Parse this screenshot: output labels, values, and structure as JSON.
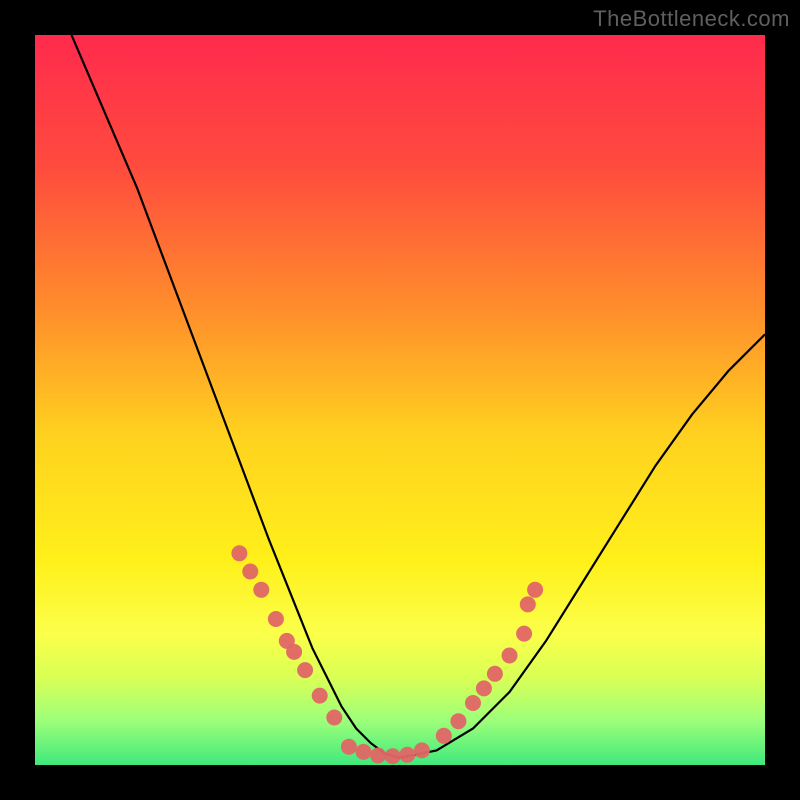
{
  "watermark": "TheBottleneck.com",
  "chart_data": {
    "type": "line",
    "title": "",
    "xlabel": "",
    "ylabel": "",
    "xlim": [
      0,
      100
    ],
    "ylim": [
      0,
      100
    ],
    "grid": false,
    "background": "vertical-gradient red→yellow→green",
    "series": [
      {
        "name": "bottleneck-curve",
        "type": "line",
        "x": [
          5,
          8,
          11,
          14,
          17,
          20,
          23,
          26,
          29,
          32,
          34,
          36,
          38,
          40,
          42,
          44,
          46,
          48,
          50,
          55,
          60,
          65,
          70,
          75,
          80,
          85,
          90,
          95,
          100
        ],
        "y": [
          100,
          93,
          86,
          79,
          71,
          63,
          55,
          47,
          39,
          31,
          26,
          21,
          16,
          12,
          8,
          5,
          3,
          1.5,
          1,
          2,
          5,
          10,
          17,
          25,
          33,
          41,
          48,
          54,
          59
        ]
      },
      {
        "name": "left-dots",
        "type": "scatter",
        "color": "#e06666",
        "x": [
          28,
          29.5,
          31,
          33,
          34.5,
          35.5,
          37,
          39,
          41
        ],
        "y": [
          29,
          26.5,
          24,
          20,
          17,
          15.5,
          13,
          9.5,
          6.5
        ]
      },
      {
        "name": "bottom-dots",
        "type": "scatter",
        "color": "#e06666",
        "x": [
          43,
          45,
          47,
          49,
          51,
          53
        ],
        "y": [
          2.5,
          1.8,
          1.3,
          1.2,
          1.4,
          2.0
        ]
      },
      {
        "name": "right-dots",
        "type": "scatter",
        "color": "#e06666",
        "x": [
          56,
          58,
          60,
          61.5,
          63,
          65,
          67,
          67.5,
          68.5
        ],
        "y": [
          4,
          6,
          8.5,
          10.5,
          12.5,
          15,
          18,
          22,
          24
        ]
      }
    ],
    "gradient_stops": [
      {
        "offset": 0,
        "color": "#ff2a4d"
      },
      {
        "offset": 18,
        "color": "#ff4b3e"
      },
      {
        "offset": 38,
        "color": "#ff8f2b"
      },
      {
        "offset": 55,
        "color": "#ffd21f"
      },
      {
        "offset": 72,
        "color": "#fff01a"
      },
      {
        "offset": 82,
        "color": "#fbff4a"
      },
      {
        "offset": 88,
        "color": "#d9ff55"
      },
      {
        "offset": 94,
        "color": "#9cff7a"
      },
      {
        "offset": 100,
        "color": "#3fe97c"
      }
    ]
  }
}
